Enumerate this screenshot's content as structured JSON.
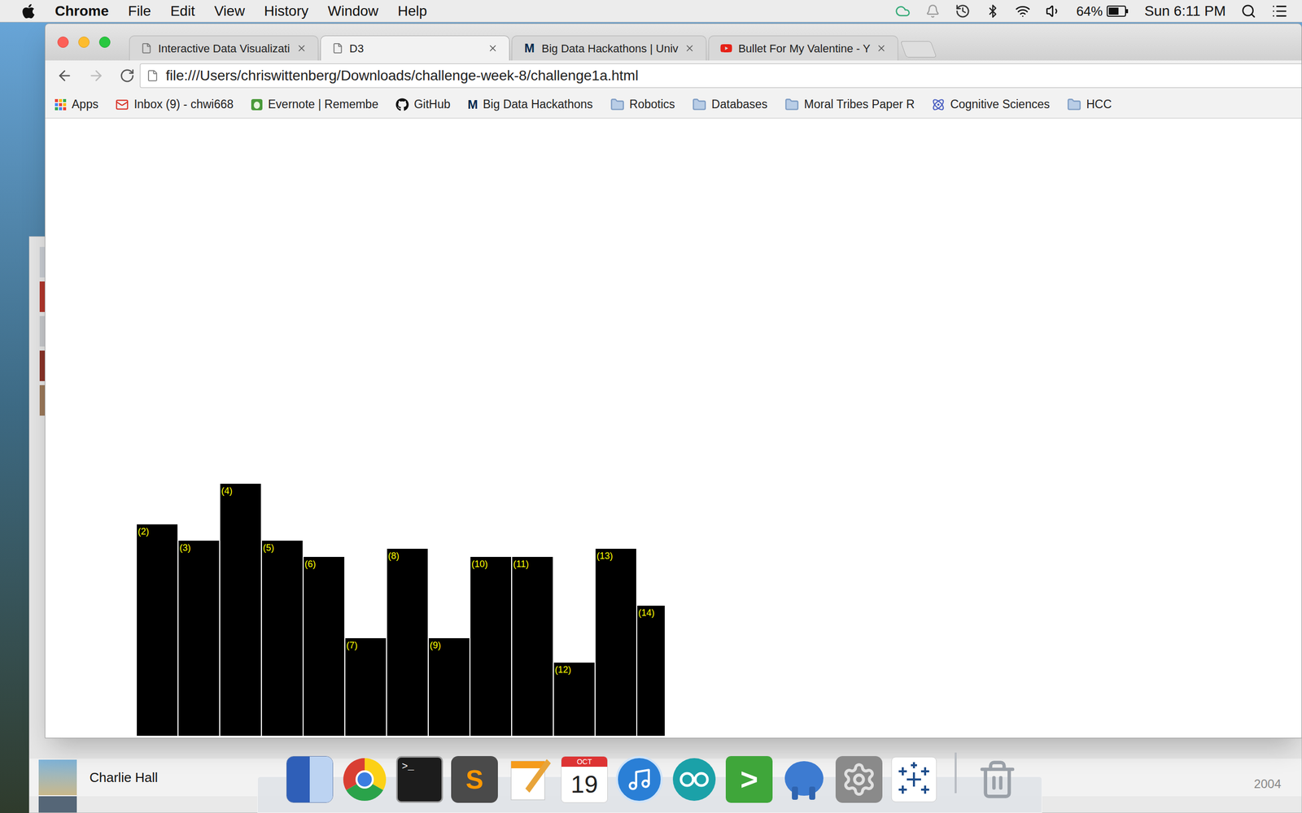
{
  "menu_bar": {
    "app": "Chrome",
    "menus": [
      "File",
      "Edit",
      "View",
      "History",
      "Window",
      "Help"
    ],
    "battery": "64%",
    "battery_level": 0.64,
    "clock": "Sun 6:11 PM"
  },
  "browser": {
    "tabs": [
      {
        "title": "Interactive Data Visualizati",
        "selected": false,
        "favicon": "page"
      },
      {
        "title": "D3",
        "selected": true,
        "favicon": "page"
      },
      {
        "title": "Big Data Hackathons | Univ",
        "selected": false,
        "favicon": "umich",
        "glyph": "M"
      },
      {
        "title": "Bullet For My Valentine - Y",
        "selected": false,
        "favicon": "youtube"
      }
    ],
    "back_enabled": true,
    "forward_enabled": false,
    "address": "file:///Users/chriswittenberg/Downloads/challenge-week-8/challenge1a.html",
    "bookmarks": [
      {
        "label": "Apps",
        "kind": "apps"
      },
      {
        "label": "Inbox (9) - chwi668",
        "kind": "gmail"
      },
      {
        "label": "Evernote | Remembe",
        "kind": "evernote"
      },
      {
        "label": "GitHub",
        "kind": "github"
      },
      {
        "label": "Big Data Hackathons",
        "kind": "umich",
        "glyph": "M"
      },
      {
        "label": "Robotics",
        "kind": "folder"
      },
      {
        "label": "Databases",
        "kind": "folder"
      },
      {
        "label": "Moral Tribes Paper R",
        "kind": "folder"
      },
      {
        "label": "Cognitive Sciences",
        "kind": "site"
      },
      {
        "label": "HCC",
        "kind": "folder"
      }
    ]
  },
  "chart": {
    "labels": [
      "(2)",
      "(3)",
      "(4)",
      "(5)",
      "(6)",
      "(7)",
      "(8)",
      "(9)",
      "(10)",
      "(11)",
      "(12)",
      "(13)",
      "(14)"
    ],
    "values": [
      26,
      24,
      31,
      24,
      22,
      12,
      23,
      12,
      22,
      22,
      9,
      23,
      16
    ]
  },
  "background_window": {
    "artist": "Charlie Hall",
    "year": "2004"
  },
  "dock": [
    {
      "kind": "finder"
    },
    {
      "kind": "chrome"
    },
    {
      "kind": "terminal",
      "glyph": ">_"
    },
    {
      "kind": "sublime",
      "glyph": "S"
    },
    {
      "kind": "pages"
    },
    {
      "kind": "calendar",
      "month": "OCT",
      "day": "19"
    },
    {
      "kind": "itunes"
    },
    {
      "kind": "arduino"
    },
    {
      "kind": "prompt",
      "glyph": ">"
    },
    {
      "kind": "postgres"
    },
    {
      "kind": "preferences"
    },
    {
      "kind": "tableau"
    },
    {
      "kind": "separator"
    },
    {
      "kind": "trash"
    }
  ]
}
